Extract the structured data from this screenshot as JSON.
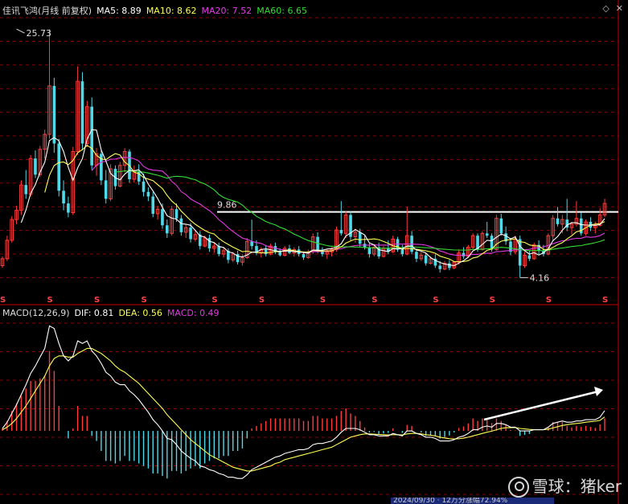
{
  "header": {
    "title": "佳讯飞鸿(月线 前复权)",
    "ma5": "MA5: 8.89",
    "ma10": "MA10: 8.62",
    "ma20": "MA20: 7.52",
    "ma60": "MA60: 6.65"
  },
  "macd_header": {
    "title": "MACD(12,26,9)",
    "dif": "DIF: 0.81",
    "dea": "DEA: 0.56",
    "macd": "MACD: 0.49"
  },
  "icons": [
    "diamond-icon",
    "close-icon"
  ],
  "bottom_note": "2024/09/30 · 12万分涨幅72.94%",
  "watermark": "雪球：猪ker",
  "colors": {
    "up": "#ff3b3b",
    "down": "#4fd8e8",
    "ma5": "#ffffff",
    "ma10": "#ffff55",
    "ma20": "#e23be2",
    "ma60": "#33dd33",
    "grid": "#8b0000",
    "dif": "#ffffff",
    "dea": "#ffff55"
  },
  "chart_data": {
    "type": "candlestick",
    "price_ylim": [
      3.0,
      27.0
    ],
    "annotations": {
      "high": {
        "label": "25.73",
        "value": 25.73,
        "index": 3
      },
      "low": {
        "label": "4.16",
        "value": 4.16,
        "index": 110
      },
      "level": {
        "label": "9.86",
        "value": 9.86
      }
    },
    "ma60_start_index": 24,
    "dividend_marker_label": "S",
    "candles": [
      [
        5.2,
        6.0,
        5.0,
        5.8
      ],
      [
        5.8,
        7.8,
        5.6,
        7.4
      ],
      [
        7.4,
        9.5,
        7.2,
        9.2
      ],
      [
        9.2,
        10.4,
        8.8,
        10.0
      ],
      [
        10.0,
        12.6,
        9.6,
        12.2
      ],
      [
        12.2,
        13.5,
        11.0,
        11.4
      ],
      [
        11.4,
        14.8,
        11.2,
        14.5
      ],
      [
        14.5,
        15.2,
        12.8,
        13.1
      ],
      [
        13.1,
        15.6,
        12.9,
        15.3
      ],
      [
        15.3,
        17.0,
        14.5,
        16.6
      ],
      [
        16.6,
        25.73,
        16.2,
        20.8
      ],
      [
        20.8,
        21.5,
        15.0,
        15.8
      ],
      [
        15.8,
        16.2,
        11.2,
        11.7
      ],
      [
        11.7,
        12.6,
        10.0,
        10.6
      ],
      [
        10.6,
        11.2,
        9.4,
        9.8
      ],
      [
        9.8,
        15.5,
        9.6,
        15.1
      ],
      [
        15.1,
        22.5,
        14.8,
        21.2
      ],
      [
        21.2,
        22.0,
        15.2,
        15.8
      ],
      [
        15.8,
        19.5,
        15.5,
        19.0
      ],
      [
        19.0,
        19.8,
        13.5,
        13.9
      ],
      [
        13.9,
        15.4,
        13.0,
        14.9
      ],
      [
        14.9,
        15.2,
        12.2,
        12.6
      ],
      [
        12.6,
        13.5,
        10.6,
        11.0
      ],
      [
        11.0,
        14.0,
        10.8,
        13.6
      ],
      [
        13.6,
        13.9,
        11.8,
        12.1
      ],
      [
        12.1,
        14.2,
        12.0,
        13.9
      ],
      [
        13.9,
        15.4,
        13.3,
        15.1
      ],
      [
        15.1,
        15.3,
        12.4,
        12.7
      ],
      [
        12.7,
        13.9,
        12.4,
        13.4
      ],
      [
        13.4,
        14.0,
        12.2,
        12.5
      ],
      [
        12.5,
        13.2,
        11.2,
        11.6
      ],
      [
        11.6,
        12.0,
        10.8,
        11.2
      ],
      [
        11.2,
        11.6,
        9.4,
        9.7
      ],
      [
        9.7,
        10.4,
        9.2,
        10.1
      ],
      [
        10.1,
        10.6,
        8.4,
        8.7
      ],
      [
        8.7,
        9.2,
        7.6,
        8.0
      ],
      [
        8.0,
        10.4,
        7.8,
        10.1
      ],
      [
        10.1,
        10.6,
        9.0,
        9.3
      ],
      [
        9.3,
        9.6,
        7.8,
        8.1
      ],
      [
        8.1,
        8.8,
        7.6,
        8.5
      ],
      [
        8.5,
        8.9,
        7.2,
        7.5
      ],
      [
        7.5,
        8.2,
        7.3,
        7.9
      ],
      [
        7.9,
        8.2,
        6.6,
        6.9
      ],
      [
        6.9,
        7.8,
        6.8,
        7.6
      ],
      [
        7.6,
        7.9,
        6.4,
        6.7
      ],
      [
        6.7,
        7.2,
        6.3,
        6.9
      ],
      [
        6.9,
        7.2,
        6.0,
        6.2
      ],
      [
        6.2,
        6.8,
        5.9,
        6.5
      ],
      [
        6.5,
        6.7,
        5.4,
        5.7
      ],
      [
        5.7,
        6.4,
        5.5,
        6.2
      ],
      [
        6.2,
        6.5,
        5.3,
        5.5
      ],
      [
        5.5,
        6.2,
        5.2,
        5.9
      ],
      [
        5.9,
        7.6,
        5.8,
        7.3
      ],
      [
        7.3,
        9.2,
        6.6,
        6.9
      ],
      [
        6.9,
        7.4,
        6.1,
        6.3
      ],
      [
        6.3,
        6.8,
        5.9,
        6.6
      ],
      [
        6.6,
        7.0,
        6.0,
        6.2
      ],
      [
        6.2,
        7.1,
        6.1,
        6.9
      ],
      [
        6.9,
        7.2,
        6.2,
        6.4
      ],
      [
        6.4,
        6.7,
        6.0,
        6.1
      ],
      [
        6.1,
        6.9,
        6.0,
        6.7
      ],
      [
        6.7,
        7.0,
        6.2,
        6.3
      ],
      [
        6.3,
        6.8,
        6.0,
        6.6
      ],
      [
        6.6,
        6.9,
        6.0,
        6.2
      ],
      [
        6.2,
        6.4,
        5.7,
        5.9
      ],
      [
        5.9,
        6.6,
        5.8,
        6.4
      ],
      [
        6.4,
        8.0,
        6.2,
        7.7
      ],
      [
        7.7,
        8.1,
        6.3,
        6.5
      ],
      [
        6.5,
        6.8,
        6.0,
        6.2
      ],
      [
        6.2,
        6.6,
        5.8,
        6.4
      ],
      [
        6.4,
        6.8,
        6.0,
        6.6
      ],
      [
        6.6,
        8.6,
        6.4,
        8.3
      ],
      [
        8.3,
        10.8,
        7.8,
        8.0
      ],
      [
        8.0,
        9.9,
        7.6,
        9.6
      ],
      [
        9.6,
        9.9,
        7.4,
        7.7
      ],
      [
        7.7,
        8.4,
        7.2,
        8.1
      ],
      [
        8.1,
        8.4,
        6.8,
        7.1
      ],
      [
        7.1,
        7.8,
        6.6,
        6.8
      ],
      [
        6.8,
        7.2,
        5.9,
        6.2
      ],
      [
        6.2,
        7.0,
        6.0,
        6.8
      ],
      [
        6.8,
        7.2,
        5.8,
        6.0
      ],
      [
        6.0,
        6.9,
        5.9,
        6.7
      ],
      [
        6.7,
        7.4,
        6.2,
        6.4
      ],
      [
        6.4,
        7.8,
        6.3,
        7.5
      ],
      [
        7.5,
        7.7,
        6.4,
        6.6
      ],
      [
        6.6,
        7.0,
        6.0,
        6.2
      ],
      [
        6.2,
        10.3,
        6.1,
        7.8
      ],
      [
        7.8,
        8.2,
        6.2,
        6.4
      ],
      [
        6.4,
        6.6,
        5.5,
        5.8
      ],
      [
        5.8,
        6.4,
        5.6,
        6.1
      ],
      [
        6.1,
        6.3,
        5.2,
        5.4
      ],
      [
        5.4,
        6.0,
        5.3,
        5.8
      ],
      [
        5.8,
        6.2,
        5.0,
        5.2
      ],
      [
        5.2,
        5.6,
        4.6,
        4.9
      ],
      [
        4.9,
        5.6,
        4.8,
        5.4
      ],
      [
        5.4,
        5.7,
        4.8,
        5.0
      ],
      [
        5.0,
        5.6,
        4.9,
        5.5
      ],
      [
        5.5,
        6.6,
        5.3,
        6.3
      ],
      [
        6.3,
        6.8,
        5.8,
        6.0
      ],
      [
        6.0,
        7.0,
        5.9,
        6.8
      ],
      [
        6.8,
        8.0,
        6.6,
        7.8
      ],
      [
        7.8,
        8.0,
        6.4,
        6.6
      ],
      [
        6.6,
        8.2,
        6.5,
        8.0
      ],
      [
        8.0,
        9.0,
        7.6,
        7.8
      ],
      [
        7.8,
        8.0,
        6.4,
        6.6
      ],
      [
        6.6,
        9.6,
        6.5,
        9.3
      ],
      [
        9.3,
        9.7,
        7.8,
        8.0
      ],
      [
        8.0,
        8.6,
        7.0,
        7.3
      ],
      [
        7.3,
        7.6,
        6.1,
        6.4
      ],
      [
        6.4,
        7.8,
        6.2,
        7.5
      ],
      [
        7.5,
        7.8,
        4.16,
        5.2
      ],
      [
        5.2,
        6.4,
        5.0,
        6.1
      ],
      [
        6.1,
        6.5,
        5.6,
        5.8
      ],
      [
        5.8,
        7.2,
        5.7,
        7.0
      ],
      [
        7.0,
        7.4,
        6.2,
        6.5
      ],
      [
        6.5,
        7.0,
        6.0,
        6.2
      ],
      [
        6.2,
        8.0,
        6.1,
        7.8
      ],
      [
        7.8,
        9.6,
        7.4,
        9.3
      ],
      [
        9.3,
        10.3,
        8.6,
        8.8
      ],
      [
        8.8,
        9.6,
        8.0,
        9.2
      ],
      [
        9.2,
        11.0,
        8.2,
        8.5
      ],
      [
        8.5,
        9.0,
        7.9,
        8.8
      ],
      [
        8.8,
        10.8,
        8.6,
        9.3
      ],
      [
        9.3,
        9.8,
        7.8,
        8.0
      ],
      [
        8.0,
        9.2,
        7.8,
        9.0
      ],
      [
        9.0,
        9.4,
        8.2,
        8.5
      ],
      [
        8.5,
        9.0,
        8.0,
        8.7
      ],
      [
        8.7,
        10.2,
        8.6,
        9.6
      ],
      [
        9.6,
        11.0,
        9.4,
        10.6
      ]
    ],
    "macd": {
      "ylim": [
        -2.6,
        4.6
      ],
      "dif": [
        0.1,
        0.35,
        0.7,
        1.05,
        1.45,
        1.85,
        2.3,
        2.6,
        2.95,
        3.3,
        4.2,
        4.1,
        3.5,
        3.0,
        2.8,
        3.0,
        3.6,
        3.5,
        3.6,
        3.2,
        3.0,
        2.7,
        2.35,
        2.2,
        1.95,
        1.85,
        1.85,
        1.6,
        1.45,
        1.25,
        1.0,
        0.75,
        0.45,
        0.25,
        0.0,
        -0.3,
        -0.35,
        -0.55,
        -0.8,
        -0.95,
        -1.1,
        -1.2,
        -1.4,
        -1.45,
        -1.55,
        -1.6,
        -1.7,
        -1.75,
        -1.85,
        -1.85,
        -1.9,
        -1.9,
        -1.75,
        -1.55,
        -1.45,
        -1.35,
        -1.25,
        -1.15,
        -1.05,
        -1.0,
        -0.9,
        -0.85,
        -0.8,
        -0.75,
        -0.75,
        -0.7,
        -0.55,
        -0.5,
        -0.5,
        -0.45,
        -0.4,
        -0.25,
        -0.05,
        0.1,
        0.1,
        0.1,
        0.05,
        -0.05,
        -0.15,
        -0.15,
        -0.2,
        -0.2,
        -0.2,
        -0.1,
        -0.15,
        -0.2,
        0.0,
        0.0,
        -0.1,
        -0.15,
        -0.25,
        -0.25,
        -0.3,
        -0.4,
        -0.4,
        -0.4,
        -0.35,
        -0.25,
        -0.2,
        -0.1,
        0.05,
        0.05,
        0.15,
        0.2,
        0.15,
        0.3,
        0.3,
        0.25,
        0.15,
        0.15,
        0.0,
        0.0,
        0.0,
        0.05,
        0.05,
        0.05,
        0.15,
        0.3,
        0.35,
        0.4,
        0.35,
        0.35,
        0.4,
        0.4,
        0.45,
        0.45,
        0.45,
        0.55,
        0.81
      ],
      "dea": [
        0.05,
        0.15,
        0.3,
        0.5,
        0.75,
        1.0,
        1.3,
        1.6,
        1.9,
        2.2,
        2.6,
        2.9,
        3.0,
        3.0,
        2.95,
        2.95,
        3.1,
        3.2,
        3.3,
        3.3,
        3.2,
        3.1,
        2.95,
        2.8,
        2.6,
        2.45,
        2.35,
        2.2,
        2.05,
        1.9,
        1.7,
        1.5,
        1.3,
        1.1,
        0.9,
        0.65,
        0.45,
        0.25,
        0.05,
        -0.15,
        -0.35,
        -0.5,
        -0.65,
        -0.8,
        -0.95,
        -1.05,
        -1.15,
        -1.25,
        -1.35,
        -1.45,
        -1.5,
        -1.55,
        -1.6,
        -1.6,
        -1.55,
        -1.5,
        -1.45,
        -1.4,
        -1.3,
        -1.25,
        -1.15,
        -1.1,
        -1.05,
        -1.0,
        -0.95,
        -0.9,
        -0.85,
        -0.8,
        -0.75,
        -0.7,
        -0.65,
        -0.55,
        -0.45,
        -0.35,
        -0.25,
        -0.2,
        -0.15,
        -0.12,
        -0.12,
        -0.13,
        -0.14,
        -0.15,
        -0.16,
        -0.15,
        -0.15,
        -0.16,
        -0.12,
        -0.1,
        -0.1,
        -0.12,
        -0.15,
        -0.17,
        -0.2,
        -0.25,
        -0.28,
        -0.31,
        -0.32,
        -0.31,
        -0.29,
        -0.25,
        -0.2,
        -0.15,
        -0.1,
        -0.05,
        -0.01,
        0.05,
        0.1,
        0.13,
        0.13,
        0.14,
        0.1,
        0.08,
        0.06,
        0.05,
        0.05,
        0.05,
        0.07,
        0.12,
        0.17,
        0.22,
        0.25,
        0.28,
        0.3,
        0.32,
        0.35,
        0.37,
        0.39,
        0.42,
        0.56
      ]
    }
  }
}
